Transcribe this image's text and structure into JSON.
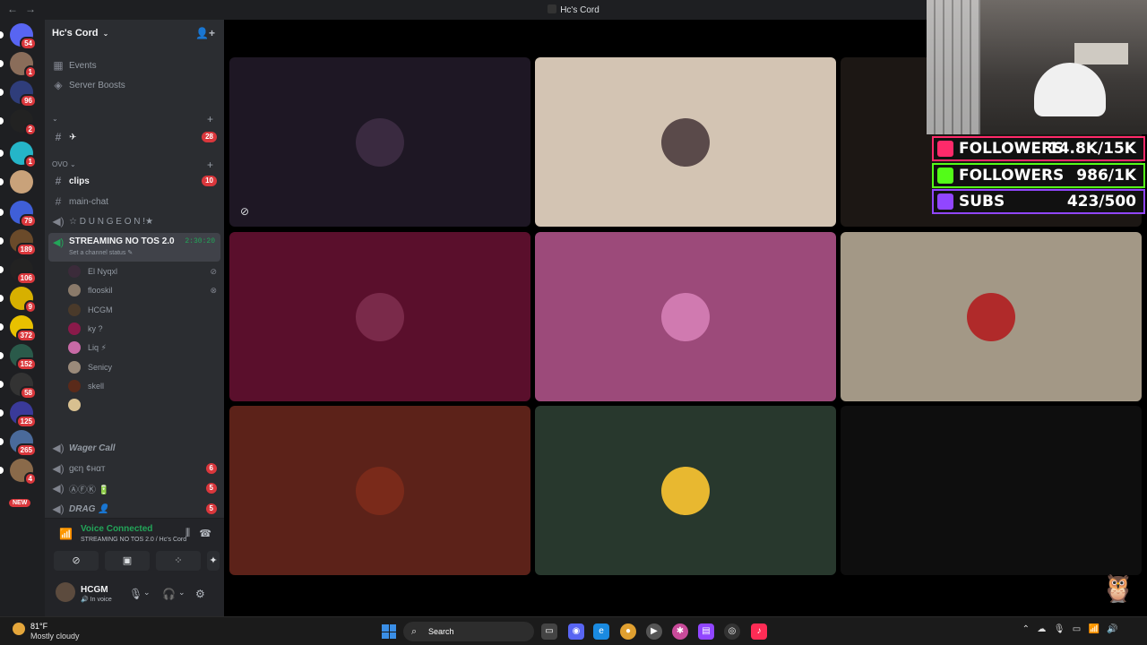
{
  "window": {
    "title": "Hc's Cord",
    "back": "←",
    "forward": "→"
  },
  "server": {
    "name": "Hc's Cord",
    "chevron": "⌄",
    "invite_icon": "person-add-icon"
  },
  "guilds": [
    {
      "badge": "54",
      "color": "#5865f2"
    },
    {
      "badge": "1",
      "color": "#8a6d5a"
    },
    {
      "badge": "96",
      "color": "#2f3d7a"
    },
    {
      "badge": "2",
      "color": "#222"
    },
    {
      "badge": "1",
      "color": "#25b5c8"
    },
    {
      "badge": "",
      "color": "#c9a27a"
    },
    {
      "badge": "79",
      "color": "#3f5fd8"
    },
    {
      "badge": "189",
      "color": "#6a4a2a"
    },
    {
      "badge": "106",
      "color": "#222"
    },
    {
      "badge": "9",
      "color": "#d7b000"
    },
    {
      "badge": "372",
      "color": "#e8c100"
    },
    {
      "badge": "152",
      "color": "#2a5a4a"
    },
    {
      "badge": "58",
      "color": "#333"
    },
    {
      "badge": "125",
      "color": "#3a3a9a"
    },
    {
      "badge": "265",
      "color": "#4a6a9a"
    },
    {
      "badge": "4",
      "color": "#8a6a4a"
    }
  ],
  "guild_new": "NEW",
  "sidebar": {
    "events": "Events",
    "boosts": "Server Boosts",
    "cat1": "⌄",
    "chan_plane": "✈",
    "chan_plane_count": "28",
    "cat2": "OVO ⌄",
    "clips": "clips",
    "clips_count": "10",
    "main_chat": "main-chat",
    "dungeon": "☆ D U N G E O N !★",
    "streaming": {
      "name": "STREAMING NO TOS 2.0",
      "timer": "2:30:20",
      "status": "Set a channel status ✎"
    },
    "members": [
      {
        "name": "El Nyqxl",
        "end": "⊘",
        "color": "#3b2b3a"
      },
      {
        "name": "flooskil",
        "end": "⊗",
        "color": "#8a7a6a"
      },
      {
        "name": "HCGM",
        "end": "",
        "color": "#4a3a2a"
      },
      {
        "name": "ky ?",
        "end": "",
        "color": "#8a1a4a"
      },
      {
        "name": "Liq ⚡",
        "end": "",
        "color": "#c86aa6"
      },
      {
        "name": "Senicy",
        "end": "",
        "color": "#9a8a7a"
      },
      {
        "name": "skell",
        "end": "",
        "color": "#5a2a1a"
      },
      {
        "name": "",
        "end": "",
        "color": "#d8c090"
      }
    ],
    "wager_call": "Wager Call",
    "gen_chat": "ɡєη ¢нαт",
    "gen_chat_count": "6",
    "afk": "ⒶⒻⓀ 🔋",
    "afk_count": "5",
    "drag": "DRAG 👤",
    "drag_count": "5"
  },
  "voice": {
    "status": "Voice Connected",
    "channel": "STREAMING NO TOS 2.0 / Hc's Cord"
  },
  "user": {
    "name": "HCGM",
    "status": "🔊 In voice"
  },
  "tiles": [
    {
      "bg": "#1e1724",
      "avatar": "#3a2a40"
    },
    {
      "bg": "#d3c4b3",
      "avatar": "#5a4a4a"
    },
    {
      "bg": "#1c1714",
      "avatar": ""
    },
    {
      "bg": "#5a0f2c",
      "avatar": "#7a2a4a"
    },
    {
      "bg": "#9c4a7a",
      "avatar": "#d07ab0"
    },
    {
      "bg": "#a39886",
      "avatar": "#b02a2a"
    },
    {
      "bg": "#5c2219",
      "avatar": "#7a2a1a"
    },
    {
      "bg": "#28382d",
      "avatar": "#e8b830"
    },
    {
      "bg": "#0e0e0e",
      "avatar": ""
    }
  ],
  "overlay": {
    "tiktok": {
      "label": "FOLLOWERS",
      "value": "14.8K/15K",
      "color": "#ff2a6a"
    },
    "kick": {
      "label": "FOLLOWERS",
      "value": "986/1K",
      "color": "#53fc18"
    },
    "twitch": {
      "label": "SUBS",
      "value": "423/500",
      "color": "#9146ff"
    }
  },
  "taskbar": {
    "temp": "81°F",
    "weather": "Mostly cloudy",
    "search": "Search",
    "discord_badge": "9+"
  }
}
